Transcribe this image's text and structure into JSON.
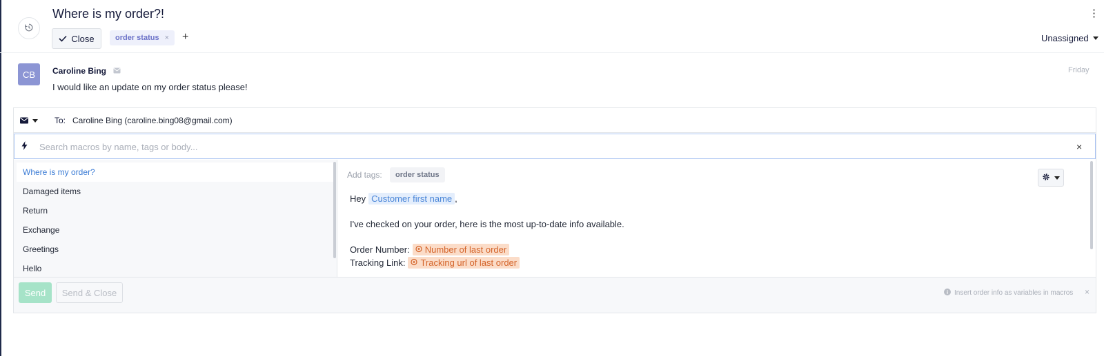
{
  "ticket": {
    "title": "Where is my order?!",
    "close_label": "Close",
    "tags": [
      {
        "label": "order status",
        "remove": "×"
      }
    ],
    "add_tag": "+",
    "menu": "⋮",
    "assignee": "Unassigned"
  },
  "message": {
    "avatar_initials": "CB",
    "sender": "Caroline Bing",
    "date": "Friday",
    "body": "I would like an update on my order status please!"
  },
  "reply": {
    "to_label": "To:",
    "to_value": "Caroline Bing (caroline.bing08@gmail.com)",
    "search_placeholder": "Search macros by name, tags or body...",
    "search_clear": "×",
    "macros": [
      {
        "label": "Where is my order?",
        "active": true
      },
      {
        "label": "Damaged items"
      },
      {
        "label": "Return"
      },
      {
        "label": "Exchange"
      },
      {
        "label": "Greetings"
      },
      {
        "label": "Hello"
      }
    ],
    "preview": {
      "add_tags_label": "Add tags:",
      "tag": "order status",
      "greeting": "Hey",
      "var_first_name": "Customer first name",
      "greeting_punct": ",",
      "line2": "I've checked on your order, here is the most up-to-date info available.",
      "order_number_label": "Order Number:",
      "var_order_number": "Number of last order",
      "tracking_label": "Tracking Link:",
      "var_tracking": "Tracking url of last order"
    },
    "send_label": "Send",
    "send_close_label": "Send & Close",
    "hint": "Insert order info as variables in macros",
    "hint_close": "×"
  },
  "colors": {
    "accent_blue": "#3a7bd5",
    "send_green": "#a6e3c8",
    "variable_orange": "#d4642a",
    "avatar": "#8c95d4"
  }
}
